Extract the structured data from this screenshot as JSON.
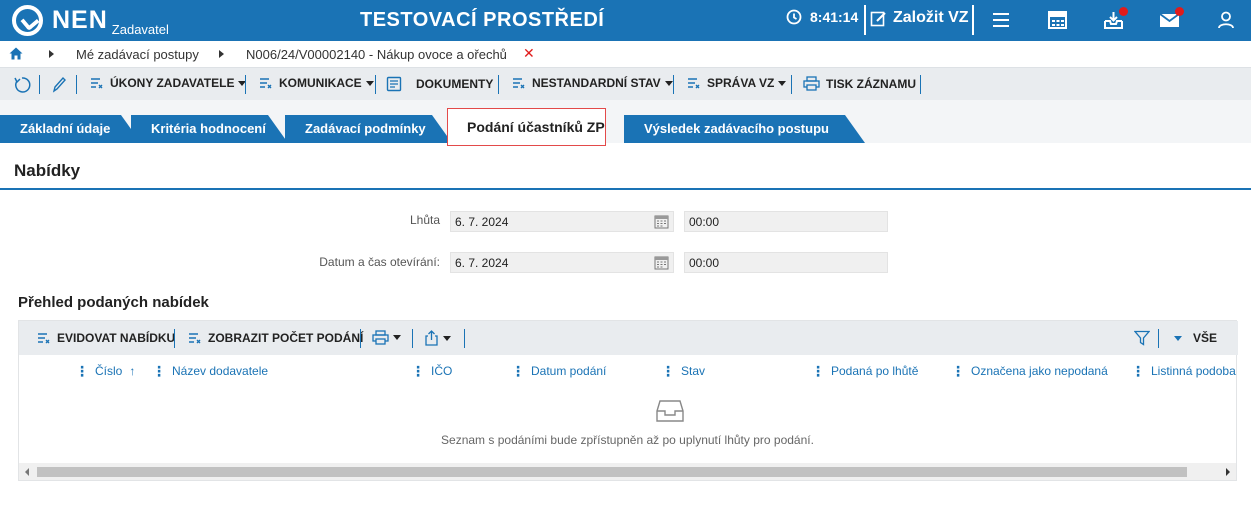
{
  "header": {
    "logo_text": "NEN",
    "logo_sub": "Zadavatel",
    "environment": "TESTOVACÍ PROSTŘEDÍ",
    "time": "8:41:14",
    "create_label": "Založit VZ",
    "icons": [
      "menu-icon",
      "calculator-icon",
      "inbox-download-icon",
      "mail-icon",
      "user-icon"
    ],
    "accent": "#1a73b5",
    "notification_color": "#e01b1b"
  },
  "breadcrumb": {
    "items": [
      "Mé zadávací postupy",
      "N006/24/V00002140 - Nákup ovoce a ořechů"
    ],
    "close": "✕"
  },
  "toolbar": {
    "ukony": "ÚKONY ZADAVATELE",
    "komunikace": "KOMUNIKACE",
    "dokumenty": "DOKUMENTY",
    "nestandardni": "NESTANDARDNÍ STAV",
    "sprava": "SPRÁVA VZ",
    "tisk": "TISK ZÁZNAMU"
  },
  "tabs": [
    {
      "label": "Základní údaje",
      "active": false
    },
    {
      "label": "Kritéria hodnocení",
      "active": false
    },
    {
      "label": "Zadávací podmínky",
      "active": false
    },
    {
      "label": "Podání účastníků ZP",
      "active": true
    },
    {
      "label": "Výsledek zadávacího postupu",
      "active": false
    }
  ],
  "section": {
    "title": "Nabídky",
    "lhuta_label": "Lhůta",
    "lhuta_date": "6. 7. 2024",
    "lhuta_time": "00:00",
    "otevirani_label": "Datum a čas otevírání:",
    "otevirani_date": "6. 7. 2024",
    "otevirani_time": "00:00"
  },
  "grid": {
    "title": "Přehled podaných nabídek",
    "evidovat": "EVIDOVAT NABÍDKU",
    "zobrazit": "ZOBRAZIT POČET PODÁNÍ",
    "filter_value": "VŠE",
    "columns": [
      "Číslo",
      "Název dodavatele",
      "IČO",
      "Datum podání",
      "Stav",
      "Podaná po lhůtě",
      "Označena jako nepodaná",
      "Listinná podoba"
    ],
    "sort_indicator": "↑",
    "empty_message": "Seznam s podáními bude zpřístupněn až po uplynutí lhůty pro podání."
  }
}
